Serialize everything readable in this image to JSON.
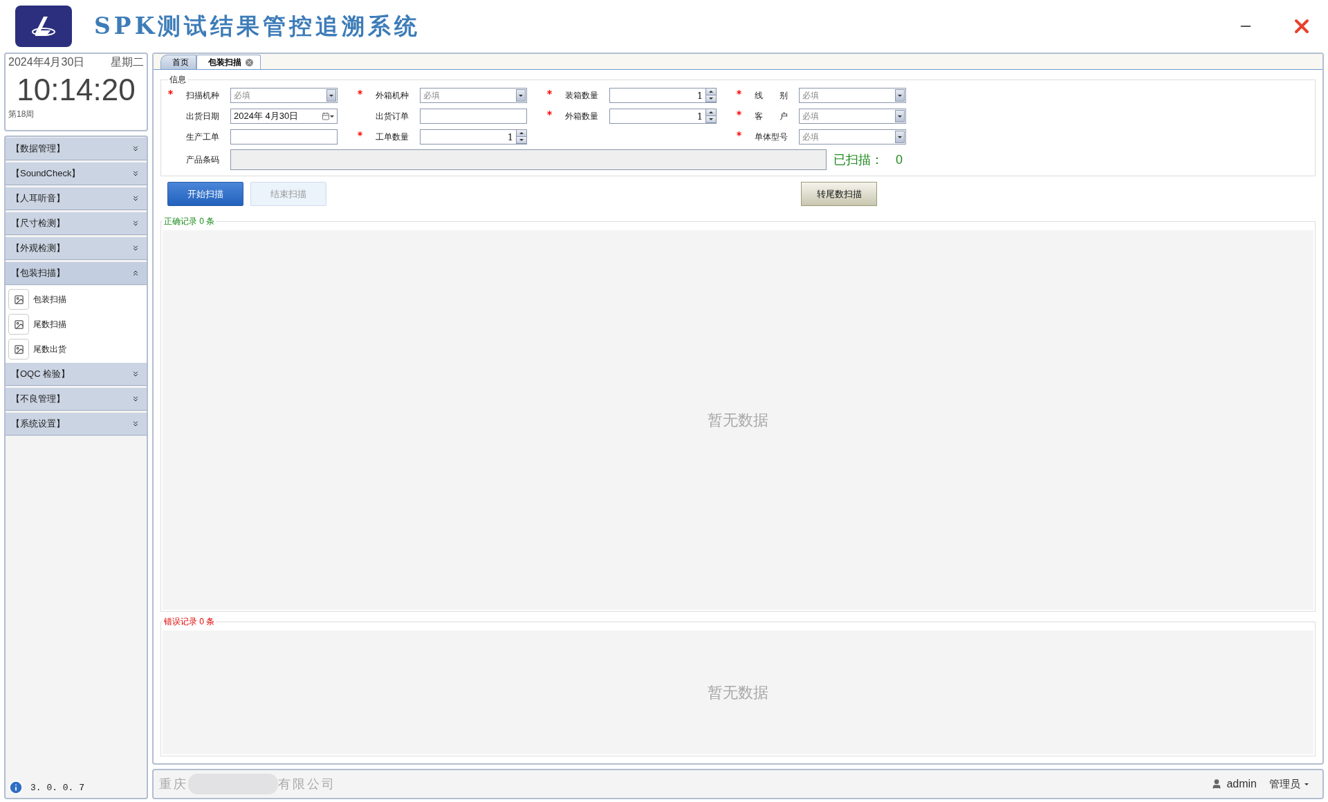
{
  "header": {
    "title": "SPK测试结果管控追溯系统"
  },
  "clock": {
    "date": "2024年4月30日",
    "weekday": "星期二",
    "time": "10:14:20",
    "week": "第18周"
  },
  "menu": [
    {
      "label": "【数据管理】",
      "expanded": false
    },
    {
      "label": "【SoundCheck】",
      "expanded": false
    },
    {
      "label": "【人耳听音】",
      "expanded": false
    },
    {
      "label": "【尺寸检测】",
      "expanded": false
    },
    {
      "label": "【外观检测】",
      "expanded": false
    },
    {
      "label": "【包装扫描】",
      "expanded": true,
      "children": [
        {
          "label": "包装扫描"
        },
        {
          "label": "尾数扫描"
        },
        {
          "label": "尾数出货"
        }
      ]
    },
    {
      "label": "【OQC 检验】",
      "expanded": false
    },
    {
      "label": "【不良管理】",
      "expanded": false
    },
    {
      "label": "【系统设置】",
      "expanded": false
    }
  ],
  "version": "3. 0. 0. 7",
  "tabs": [
    {
      "label": "首页",
      "selected": false,
      "closable": false
    },
    {
      "label": "包装扫描",
      "selected": true,
      "closable": true
    }
  ],
  "form": {
    "title": "信息",
    "columns": [
      [
        {
          "label": "扫描机种",
          "required": true,
          "kind": "select",
          "placeholder": "必填"
        },
        {
          "label": "出货日期",
          "required": false,
          "kind": "date",
          "value": "2024年  4月30日"
        },
        {
          "label": "生产工单",
          "required": false,
          "kind": "text"
        }
      ],
      [
        {
          "label": "外箱机种",
          "required": true,
          "kind": "select",
          "placeholder": "必填"
        },
        {
          "label": "出货订单",
          "required": false,
          "kind": "text"
        },
        {
          "label": "工单数量",
          "required": true,
          "kind": "spin",
          "value": "1"
        }
      ],
      [
        {
          "label": "装箱数量",
          "required": true,
          "kind": "spin",
          "value": "1"
        },
        {
          "label": "外箱数量",
          "required": true,
          "kind": "spin",
          "value": "1"
        }
      ],
      [
        {
          "label": "线　　别",
          "required": true,
          "kind": "select",
          "placeholder": "必填"
        },
        {
          "label": "客　　户",
          "required": true,
          "kind": "select",
          "placeholder": "必填"
        },
        {
          "label": "单体型号",
          "required": true,
          "kind": "select",
          "placeholder": "必填"
        }
      ]
    ],
    "barcode": {
      "label": "产品条码",
      "disabled": true
    },
    "scanned_label": "已扫描：",
    "scanned_count": "0"
  },
  "left_buttons": [
    {
      "label": "开始扫描",
      "disabled": false
    },
    {
      "label": "结束扫描",
      "disabled": true
    }
  ],
  "right_button": {
    "label": "转尾数扫描"
  },
  "records": [
    {
      "kind": "correct",
      "title": "正确记录 0 条",
      "empty_text": "暂无数据"
    },
    {
      "kind": "error",
      "title": "错误记录 0 条",
      "empty_text": "暂无数据"
    }
  ],
  "status_bar": {
    "company_start": "重庆",
    "company_end": "有限公司",
    "user": "admin",
    "role": "管理员"
  }
}
